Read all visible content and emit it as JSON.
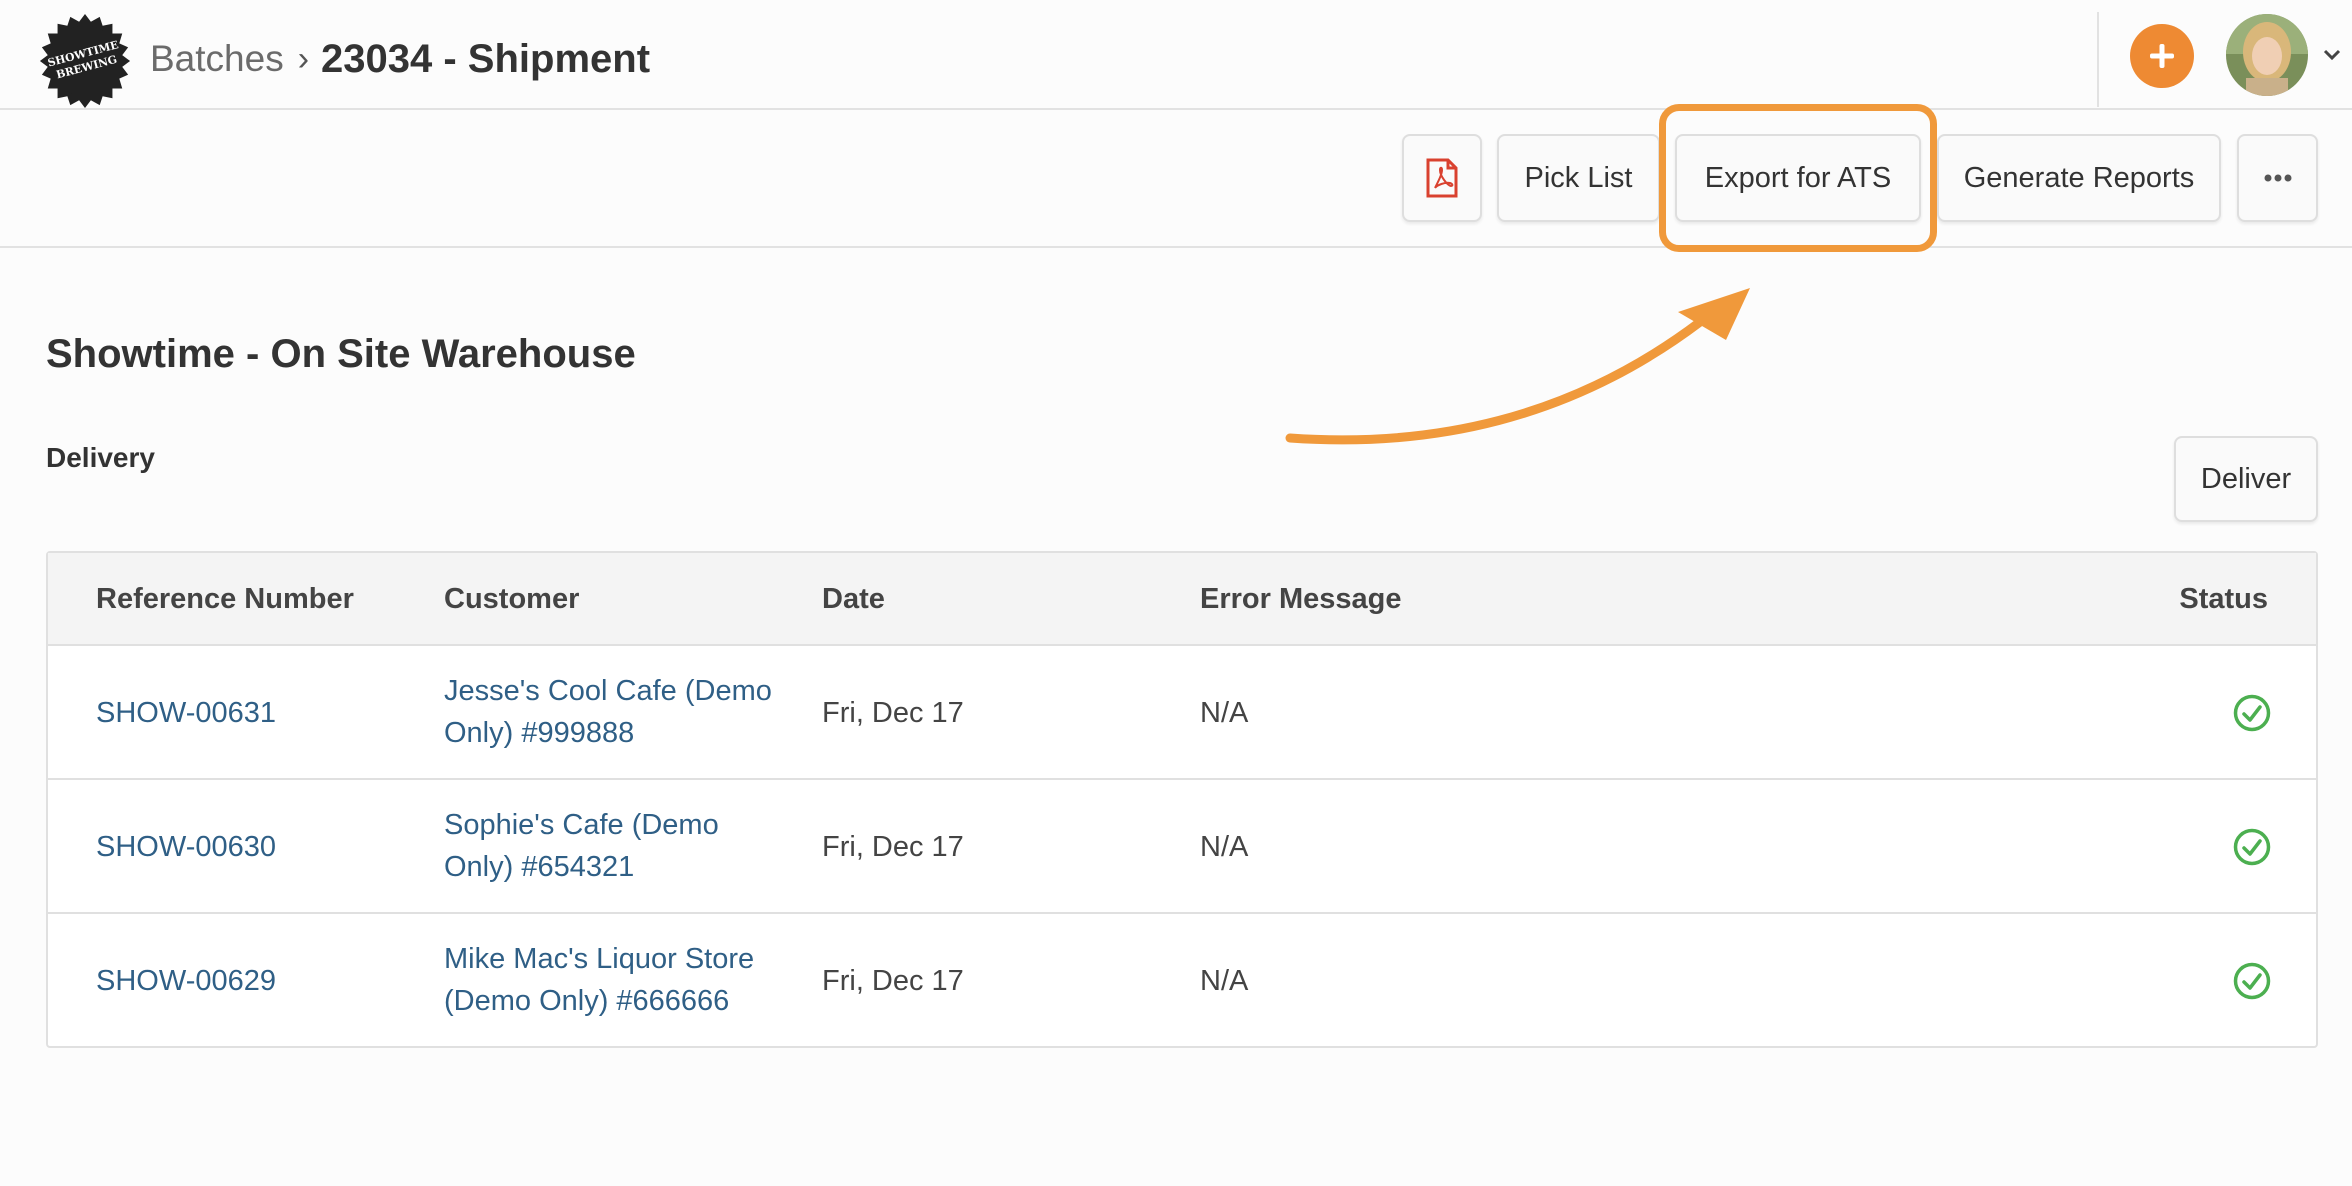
{
  "header": {
    "logo_alt": "SHOWTIME BREWING",
    "breadcrumb": {
      "parent": "Batches",
      "current": "23034 - Shipment"
    },
    "add_icon": "plus-icon",
    "avatar_icon": "user-avatar",
    "menu_icon": "chevron-down-icon"
  },
  "toolbar": {
    "pdf_icon": "pdf-icon",
    "pick_list": "Pick List",
    "export_ats": "Export for ATS",
    "generate_reports": "Generate Reports",
    "more_icon": "ellipsis-icon"
  },
  "annotation": {
    "highlight_color": "#f0993b"
  },
  "main": {
    "warehouse_title": "Showtime - On Site Warehouse",
    "section_label": "Delivery",
    "deliver_button": "Deliver"
  },
  "table": {
    "columns": [
      "Reference Number",
      "Customer",
      "Date",
      "Error Message",
      "Status"
    ],
    "rows": [
      {
        "ref": "SHOW-00631",
        "customer_line1": "Jesse's Cool Cafe (Demo",
        "customer_line2": "Only) #999888",
        "date": "Fri, Dec 17",
        "error": "N/A",
        "status": "success"
      },
      {
        "ref": "SHOW-00630",
        "customer_line1": "Sophie's Cafe (Demo",
        "customer_line2": "Only) #654321",
        "date": "Fri, Dec 17",
        "error": "N/A",
        "status": "success"
      },
      {
        "ref": "SHOW-00629",
        "customer_line1": "Mike Mac's Liquor Store",
        "customer_line2": "(Demo Only) #666666",
        "date": "Fri, Dec 17",
        "error": "N/A",
        "status": "success"
      }
    ]
  },
  "colors": {
    "accent": "#ee8a33",
    "link": "#2f5f86",
    "success": "#4caf50",
    "pdf_red": "#d9412f"
  }
}
